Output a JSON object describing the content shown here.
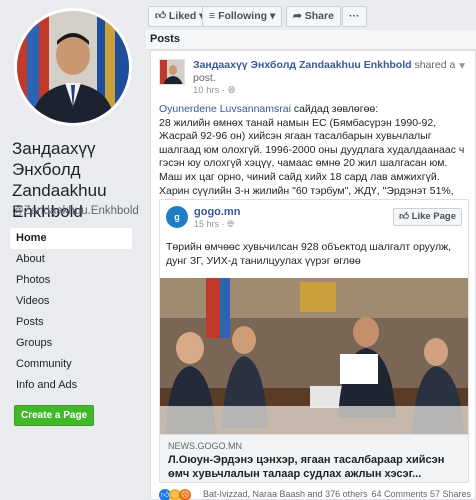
{
  "profile": {
    "name": "Зандаахүү Энхболд Zandaakhuu Enkhbold",
    "handle": "@Zandaakhuu.Enkhbold"
  },
  "nav": {
    "items": [
      {
        "label": "Home"
      },
      {
        "label": "About"
      },
      {
        "label": "Photos"
      },
      {
        "label": "Videos"
      },
      {
        "label": "Posts"
      },
      {
        "label": "Groups"
      },
      {
        "label": "Community"
      },
      {
        "label": "Info and Ads"
      }
    ],
    "create_page_label": "Create a Page"
  },
  "actions": {
    "liked_label": "Liked",
    "following_label": "Following",
    "share_label": "Share",
    "more_label": "···"
  },
  "posts_header": "Posts",
  "post": {
    "author": "Зандаахүү Энхболд Zandaakhuu Enkhbold",
    "shared_text": "shared a post.",
    "time": "10 hrs ·",
    "mention": "Oyunerdene Luvsannamsrai",
    "mention_suffix": " сайдад зөвлөгөө:",
    "body": "28 жилийн өмнөх танай намын ЕС (Бямбасүрэн 1990-92, Жасрай 92-96 он) хийсэн ягаан тасалбарын хувьчлалыг шалгаад юм олохгүй. 1996-2000 оны дуудлага худалдаанаас ч гэсэн юу олохгүй хэцүү, чамаас өмнө 20 жил шалгасан юм. Маш их цаг орно, чиний сайд хийх 18 сард лав амжихгүй. Харин сүүлийн 3-н жилийн \"60 тэрбум\", ЖДҮ, \"Эрдэнэт 51%, 49%\" гээд шалгах ажил зөндөө байна.",
    "card": {
      "source_logo": "g",
      "source_name": "gogo.mn",
      "source_time": "15 hrs ·",
      "like_page_label": "Like Page",
      "text": "Төрийн өмчөөс хувьчилсан 928 объектод шалгалт оруулж, дунг ЗГ, УИХ-д танилцуулах үүрэг өглөө",
      "footer_domain": "NEWS.GOGO.MN",
      "footer_title": "Л.Оюун-Эрдэнэ цэнхэр, ягаан тасалбараар хийсэн өмч хувьчлалын талаар судлах ажлын хэсэг..."
    },
    "reactions": {
      "names": "Bat-Ivizzad, Naraa Baash and 376 others",
      "counts": "64 Comments 57 Shares"
    }
  },
  "colors": {
    "accent": "#385898",
    "green": "#42b72a"
  }
}
